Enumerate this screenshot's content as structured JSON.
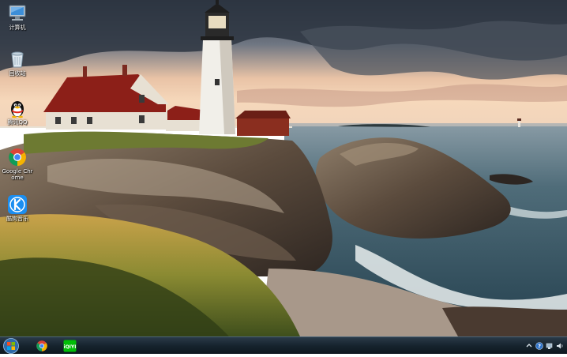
{
  "desktop": {
    "icons": [
      {
        "label": "计算机",
        "icon": "computer-icon"
      },
      {
        "label": "回收站",
        "icon": "recycle-bin-icon"
      },
      {
        "label": "腾讯QQ",
        "icon": "qq-penguin-icon"
      },
      {
        "label": "Google Chrome",
        "icon": "chrome-icon"
      },
      {
        "label": "酷狗音乐",
        "icon": "kugou-icon"
      }
    ]
  },
  "taskbar": {
    "start_icon": "windows-logo-icon",
    "pinned": [
      {
        "icon": "chrome-icon"
      },
      {
        "icon": "iqiyi-icon",
        "label": "iQIYI"
      }
    ],
    "tray": [
      "expand-arrow-icon",
      "help-icon",
      "network-icon",
      "volume-icon"
    ]
  },
  "colors": {
    "sky_top": "#3d4652",
    "sky_glow": "#f3c9a7",
    "sea": "#3f5b68",
    "taskbar": "#15222c"
  }
}
